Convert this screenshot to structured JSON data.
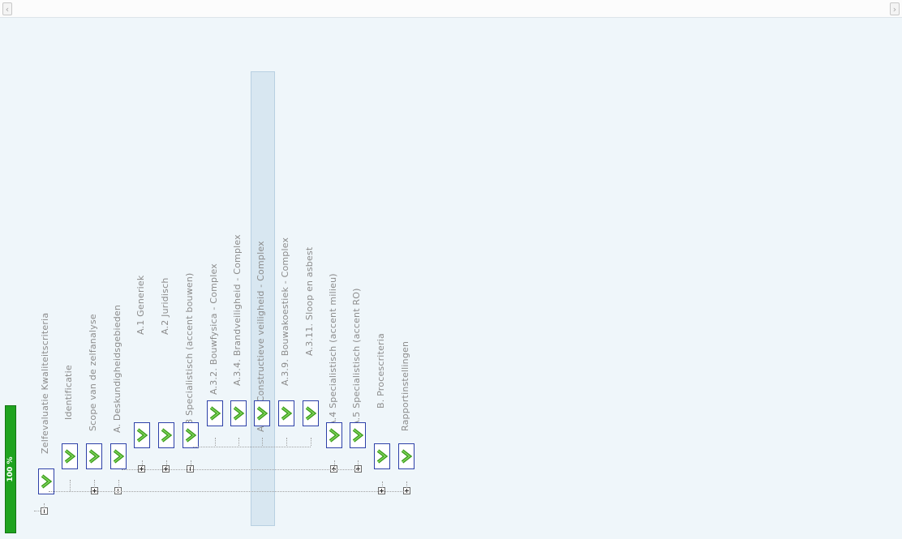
{
  "progress": {
    "label": "100 %",
    "value": 1.0
  },
  "colors": {
    "progress_fill": "#1fa31f",
    "checkbox_border": "#2d40a8",
    "check_green": "#3a9a1a",
    "selection": "#d8e7f1"
  },
  "tree": {
    "nodes": [
      {
        "label": "Zelfevaluatie Kwaliteitscriteria",
        "expander": "minus",
        "checked": true
      },
      {
        "label": "Identificatie",
        "expander": null,
        "checked": true
      },
      {
        "label": "Scope van de zelfanalyse",
        "expander": "plus",
        "checked": true
      },
      {
        "label": "A. Deskundigheidsgebieden",
        "expander": "minus",
        "checked": true
      },
      {
        "label": "A.1 Generiek",
        "expander": "plus",
        "checked": true
      },
      {
        "label": "A.2 Juridisch",
        "expander": "plus",
        "checked": true
      },
      {
        "label": "A.3 Specialistisch (accent bouwen)",
        "expander": "minus",
        "checked": true
      },
      {
        "label": "A.3.2. Bouwfysica - Complex",
        "expander": null,
        "checked": true
      },
      {
        "label": "A.3.4. Brandveiligheid - Complex",
        "expander": null,
        "checked": true
      },
      {
        "label": "A.3.6. Constructieve veiligheid - Complex",
        "expander": null,
        "checked": true,
        "selected": true
      },
      {
        "label": "A.3.9. Bouwakoestiek - Complex",
        "expander": null,
        "checked": true
      },
      {
        "label": "A.3.11. Sloop en asbest",
        "expander": null,
        "checked": true
      },
      {
        "label": "A.4 Specialistisch (accent milieu)",
        "expander": "plus",
        "checked": true
      },
      {
        "label": "A.5 Specialistisch (accent RO)",
        "expander": "plus",
        "checked": true
      },
      {
        "label": "B. Procescriteria",
        "expander": "plus",
        "checked": true
      },
      {
        "label": "Rapportinstellingen",
        "expander": "plus",
        "checked": true
      }
    ]
  },
  "icons": {
    "expand": "plus-box-icon",
    "collapse": "minus-box-icon",
    "check": "green-checkmark-icon",
    "scroll_left": "chevron-left-icon",
    "scroll_right": "chevron-right-icon"
  }
}
